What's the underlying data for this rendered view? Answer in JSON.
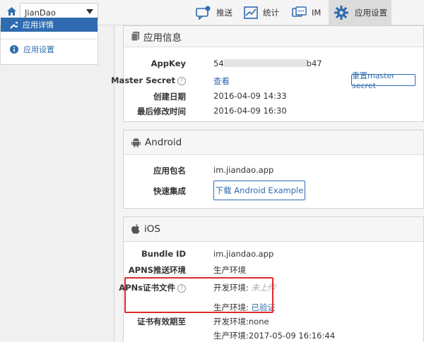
{
  "header": {
    "app_name": "JianDao",
    "nav": [
      {
        "label": "推送",
        "icon": "push-icon"
      },
      {
        "label": "统计",
        "icon": "stats-icon"
      },
      {
        "label": "IM",
        "icon": "im-icon"
      },
      {
        "label": "应用设置",
        "icon": "gear-icon"
      }
    ]
  },
  "sidebar": {
    "items": [
      {
        "label": "应用详情"
      },
      {
        "label": "应用设置"
      }
    ]
  },
  "app_info": {
    "title": "应用信息",
    "appkey_label": "AppKey",
    "appkey_prefix": "54",
    "appkey_suffix": "b47",
    "master_secret_label": "Master Secret",
    "master_secret_link": "查看",
    "reset_button": "重置master secret",
    "created_label": "创建日期",
    "created_value": "2016-04-09 14:33",
    "modified_label": "最后修改时间",
    "modified_value": "2016-04-09 16:30"
  },
  "android": {
    "title": "Android",
    "package_label": "应用包名",
    "package_value": "im.jiandao.app",
    "quick_label": "快速集成",
    "download_button": "下载 Android Example"
  },
  "ios": {
    "title": "iOS",
    "bundle_label": "Bundle ID",
    "bundle_value": "im.jiandao.app",
    "apns_env_label": "APNS推送环境",
    "apns_env_value": "生产环境",
    "cert_label": "APNs证书文件",
    "dev_env_prefix": "开发环境: ",
    "dev_env_status": "未上传",
    "prod_env_prefix": "生产环境: ",
    "prod_env_status": "已验证",
    "expiry_label": "证书有效期至",
    "expiry_dev": "开发环境:none",
    "expiry_prod": "生产环境:2017-05-09 16:16:44"
  },
  "colors": {
    "accent": "#2f6bb0",
    "highlight": "#e02a2a"
  }
}
